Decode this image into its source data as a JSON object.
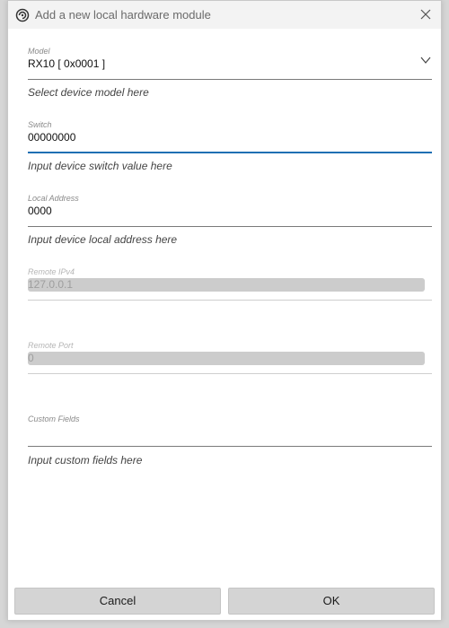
{
  "window": {
    "title": "Add a new local hardware module"
  },
  "fields": {
    "model": {
      "label": "Model",
      "value": "RX10 [ 0x0001 ]",
      "helper": "Select device model here"
    },
    "switch": {
      "label": "Switch",
      "value": "00000000",
      "helper": "Input device switch value here"
    },
    "local_address": {
      "label": "Local Address",
      "value": "0000",
      "helper": "Input device local address here"
    },
    "remote_ipv4": {
      "label": "Remote IPv4",
      "value": "127.0.0.1"
    },
    "remote_port": {
      "label": "Remote Port",
      "value": "0"
    },
    "custom_fields": {
      "label": "Custom Fields",
      "value": "",
      "helper": "Input custom fields here"
    }
  },
  "buttons": {
    "cancel": "Cancel",
    "ok": "OK"
  },
  "icons": {
    "app": "spiral-icon",
    "close": "close-icon",
    "dropdown": "chevron-down-icon"
  },
  "colors": {
    "accent": "#1f6fb3",
    "button_bg": "#d4d4d4",
    "disabled_bg": "#cccccc"
  }
}
